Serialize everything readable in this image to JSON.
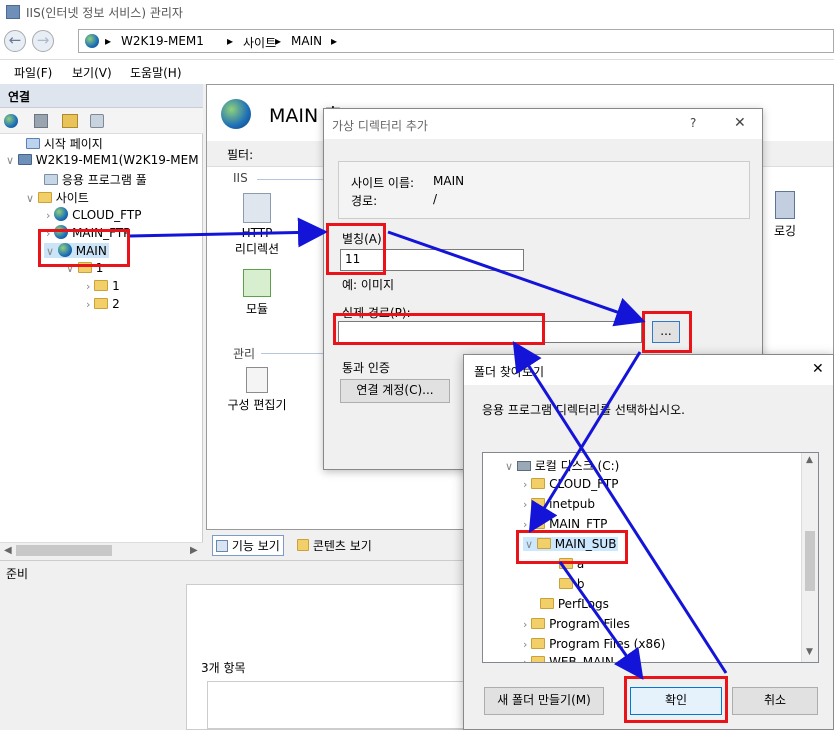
{
  "window": {
    "title": "IIS(인터넷 정보 서비스) 관리자"
  },
  "address": {
    "crumbs": [
      "W2K19-MEM1",
      "사이트",
      "MAIN"
    ]
  },
  "menu": {
    "items": [
      "파일(F)",
      "보기(V)",
      "도움말(H)"
    ]
  },
  "connections": {
    "header": "연결",
    "tree": {
      "start_page": "시작 페이지",
      "server": "W2K19-MEM1(W2K19-MEM",
      "app_pools": "응용 프로그램 풀",
      "sites": "사이트",
      "site1": "CLOUD_FTP",
      "site2": "MAIN_FTP",
      "site3": "MAIN",
      "child0": "1",
      "child1": "1",
      "child2": "2"
    }
  },
  "main": {
    "title": "MAIN 홈",
    "filter_label": "필터:",
    "group_iis": "IIS",
    "group_mgmt": "관리",
    "features": {
      "http_redirect_1": "HTTP",
      "http_redirect_2": "리디렉션",
      "modules": "모듈",
      "config_editor": "구성 편집기",
      "logging": "로깅"
    },
    "tabs": {
      "features_view": "기능 보기",
      "content_view": "콘텐츠 보기"
    }
  },
  "status": {
    "text": "준비"
  },
  "lower": {
    "items_count": "3개 항목"
  },
  "add_vdir_dialog": {
    "title": "가상 디렉터리 추가",
    "help": "?",
    "close": "✕",
    "site_name_label": "사이트 이름:",
    "site_name_value": "MAIN",
    "path_label": "경로:",
    "path_value": "/",
    "alias_label": "별칭(A):",
    "alias_value": "11",
    "example": "예: 이미지",
    "physical_path_label": "실제 경로(P):",
    "physical_path_value": "",
    "browse_button": "...",
    "passthrough_label": "통과 인증",
    "connect_as_button": "연결 계정(C)..."
  },
  "browse_folder_dialog": {
    "title": "폴더 찾아보기",
    "close": "✕",
    "instruction": "응용 프로그램 디렉터리를 선택하십시오.",
    "tree": {
      "drive": "로컬 디스크 (C:)",
      "f1": "CLOUD_FTP",
      "f2": "inetpub",
      "f3": "MAIN_FTP",
      "f4": "MAIN_SUB",
      "f4a": "a",
      "f4b": "b",
      "f5": "PerfLogs",
      "f6": "Program Files",
      "f7": "Program Files (x86)",
      "f8": "WEB_MAIN"
    },
    "new_folder_button": "새 폴더 만들기(M)",
    "ok_button": "확인",
    "cancel_button": "취소"
  },
  "colors": {
    "highlight_red": "#e8141a",
    "arrow_blue": "#1414d8"
  }
}
